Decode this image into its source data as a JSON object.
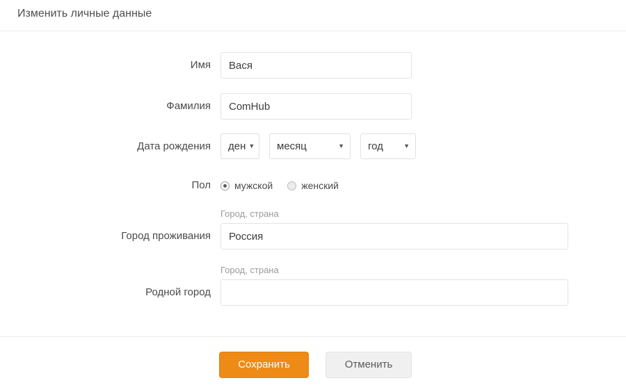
{
  "header": {
    "title": "Изменить личные данные"
  },
  "form": {
    "first_name": {
      "label": "Имя",
      "value": "Вася",
      "placeholder": ""
    },
    "last_name": {
      "label": "Фамилия",
      "value": "ComHub",
      "placeholder": ""
    },
    "birth_date": {
      "label": "Дата рождения",
      "day": {
        "selected": "ден",
        "caret": "▼"
      },
      "month": {
        "selected": "месяц",
        "caret": "▼"
      },
      "year": {
        "selected": "год",
        "caret": "▼"
      }
    },
    "gender": {
      "label": "Пол",
      "options": [
        {
          "label": "мужской",
          "selected": true
        },
        {
          "label": "женский",
          "selected": false
        }
      ]
    },
    "city_of_residence": {
      "label": "Город проживания",
      "hint": "Город, страна",
      "value": "Россия",
      "placeholder": ""
    },
    "hometown": {
      "label": "Родной город",
      "hint": "Город, страна",
      "value": "",
      "placeholder": ""
    }
  },
  "footer": {
    "save_label": "Сохранить",
    "cancel_label": "Отменить"
  },
  "colors": {
    "accent": "#ED8B16",
    "cancel_bg": "#F0F0F0",
    "border": "#E3E3E3",
    "divider": "#EBEBEB",
    "text": "#4A4A4A",
    "hint_text": "#9A9A9A"
  }
}
